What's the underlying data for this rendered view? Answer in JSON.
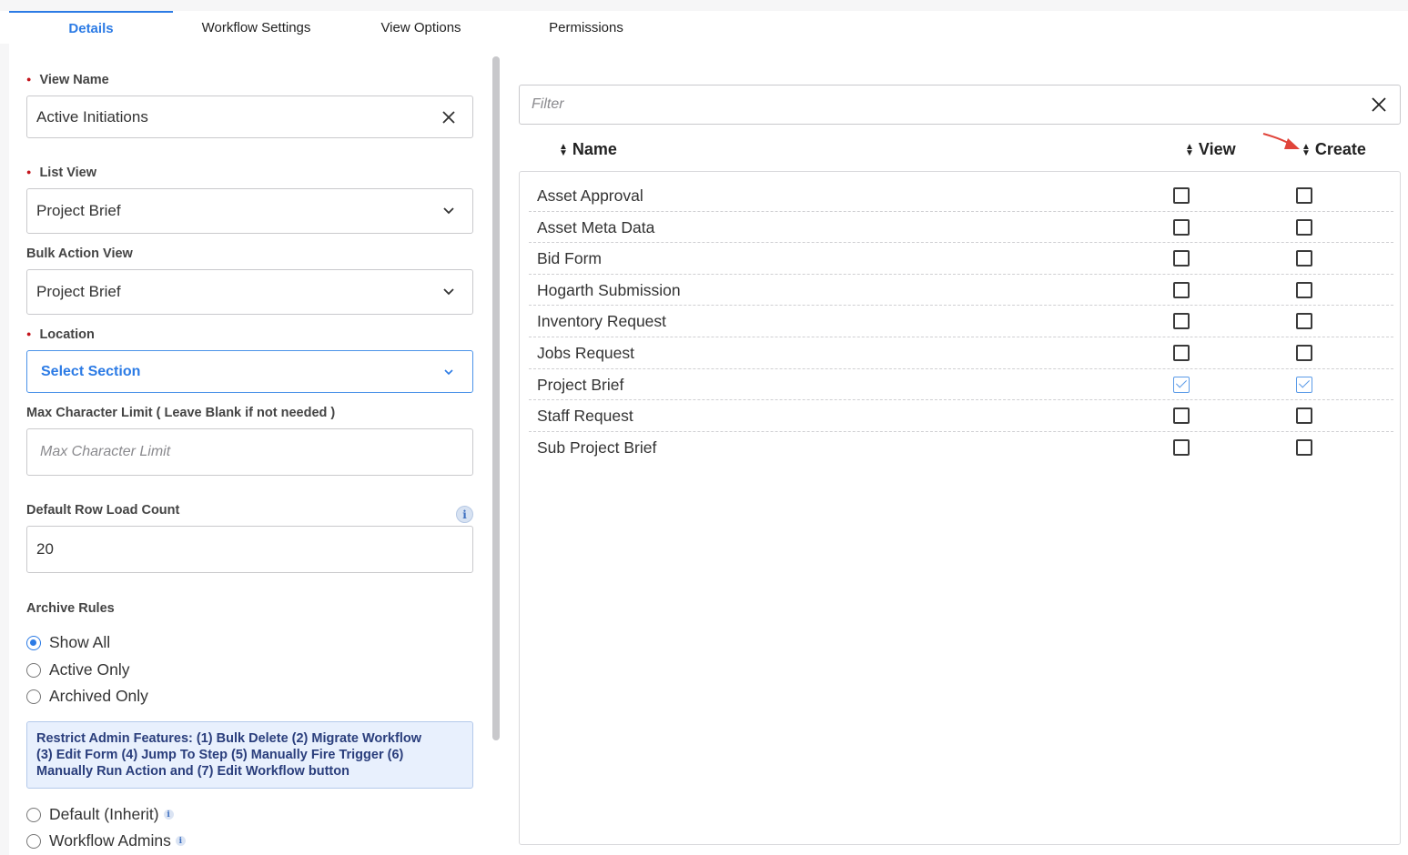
{
  "tabs": [
    {
      "label": "Details",
      "active": true
    },
    {
      "label": "Workflow Settings",
      "active": false
    },
    {
      "label": "View Options",
      "active": false
    },
    {
      "label": "Permissions",
      "active": false
    }
  ],
  "form": {
    "view_name": {
      "label": "View Name",
      "value": "Active Initiations",
      "required": true
    },
    "list_view": {
      "label": "List View",
      "value": "Project Brief",
      "required": true
    },
    "bulk_action_view": {
      "label": "Bulk Action View",
      "value": "Project Brief"
    },
    "location": {
      "label": "Location",
      "value": "Select Section",
      "required": true
    },
    "max_char": {
      "label": "Max Character Limit ( Leave Blank if not needed )",
      "placeholder": "Max Character Limit",
      "value": ""
    },
    "default_row": {
      "label": "Default Row Load Count",
      "value": "20",
      "info_icon": "info-icon"
    },
    "archive_rules": {
      "label": "Archive Rules",
      "options": [
        {
          "label": "Show All",
          "selected": true
        },
        {
          "label": "Active Only",
          "selected": false
        },
        {
          "label": "Archived Only",
          "selected": false
        }
      ]
    },
    "restrict_notice": {
      "line1": "Restrict Admin Features: (1) Bulk Delete (2) Migrate Workflow",
      "line2": "(3) Edit Form (4) Jump To Step (5) Manually Fire Trigger (6)",
      "line3": "Manually Run Action and (7) Edit Workflow button"
    },
    "restrict_options": [
      {
        "label": "Default (Inherit)",
        "selected": false
      },
      {
        "label": "Workflow Admins",
        "selected": false
      }
    ]
  },
  "permissions": {
    "filter_placeholder": "Filter",
    "columns": {
      "name": "Name",
      "view": "View",
      "create": "Create"
    },
    "rows": [
      {
        "name": "Asset Approval",
        "view": false,
        "create": false
      },
      {
        "name": "Asset Meta Data",
        "view": false,
        "create": false
      },
      {
        "name": "Bid Form",
        "view": false,
        "create": false
      },
      {
        "name": "Hogarth Submission",
        "view": false,
        "create": false
      },
      {
        "name": "Inventory Request",
        "view": false,
        "create": false
      },
      {
        "name": "Jobs Request",
        "view": false,
        "create": false
      },
      {
        "name": "Project Brief",
        "view": true,
        "create": true
      },
      {
        "name": "Staff Request",
        "view": false,
        "create": false
      },
      {
        "name": "Sub Project Brief",
        "view": false,
        "create": false
      }
    ]
  },
  "colors": {
    "accent": "#2c7be5",
    "required_dot": "#c4151c",
    "annotation_arrow": "#e0443a",
    "notice_bg": "#e8f0fd"
  }
}
